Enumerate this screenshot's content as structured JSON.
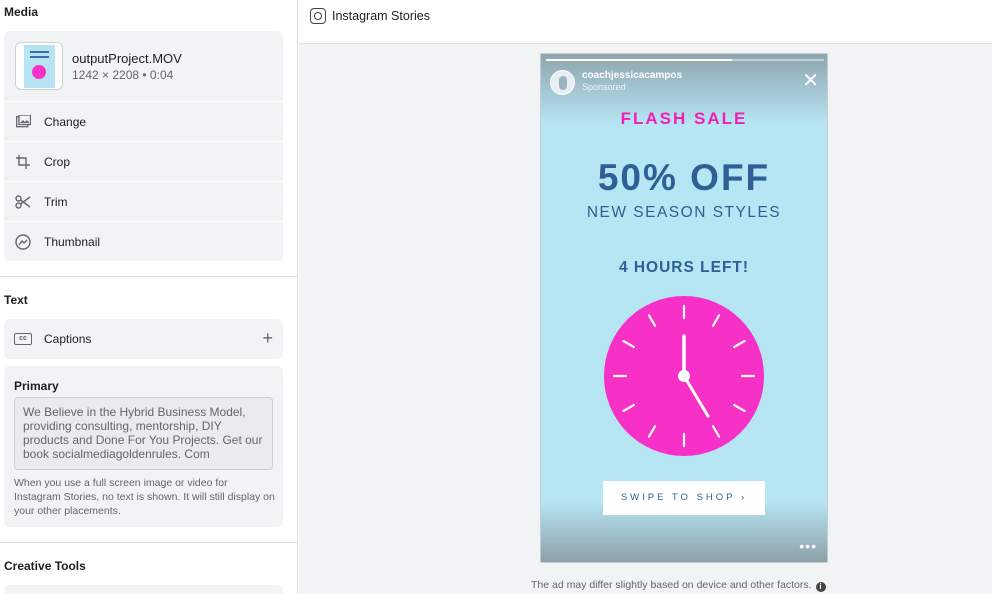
{
  "left_panel": {
    "media": {
      "title": "Media",
      "file_name": "outputProject.MOV",
      "file_meta": "1242 × 2208 • 0:04",
      "actions": [
        {
          "label": "Change",
          "icon": "image-icon"
        },
        {
          "label": "Crop",
          "icon": "crop-icon"
        },
        {
          "label": "Trim",
          "icon": "scissors-icon"
        },
        {
          "label": "Thumbnail",
          "icon": "thumbnail-icon"
        }
      ]
    },
    "text": {
      "title": "Text",
      "captions_label": "Captions",
      "captions_icon": "cc",
      "primary_title": "Primary",
      "primary_value": "We Believe in the Hybrid Business Model, providing consulting, mentorship, DIY products and Done For You Projects. Get our book socialmediagoldenrules. Com",
      "primary_note": "When you use a full screen image or video for Instagram Stories, no text is shown. It will still display on your other placements."
    },
    "creative_tools": {
      "title": "Creative Tools"
    }
  },
  "preview": {
    "placement_title": "Instagram Stories",
    "story": {
      "username": "coachjessicacampos",
      "sponsored": "Sponsored",
      "progress": 0.67,
      "flash": "FLASH SALE",
      "offer": "50% OFF",
      "subtitle": "NEW SEASON STYLES",
      "countdown": "4 HOURS LEFT!",
      "cta": "SWIPE TO SHOP ›",
      "more": "•••"
    },
    "disclaimer": "The ad may differ slightly based on device and other factors.",
    "colors": {
      "story_bg": "#b6e5f3",
      "clock": "#f730c8",
      "accent_pink": "#f21fb5",
      "text_blue": "#2e5f95"
    }
  }
}
